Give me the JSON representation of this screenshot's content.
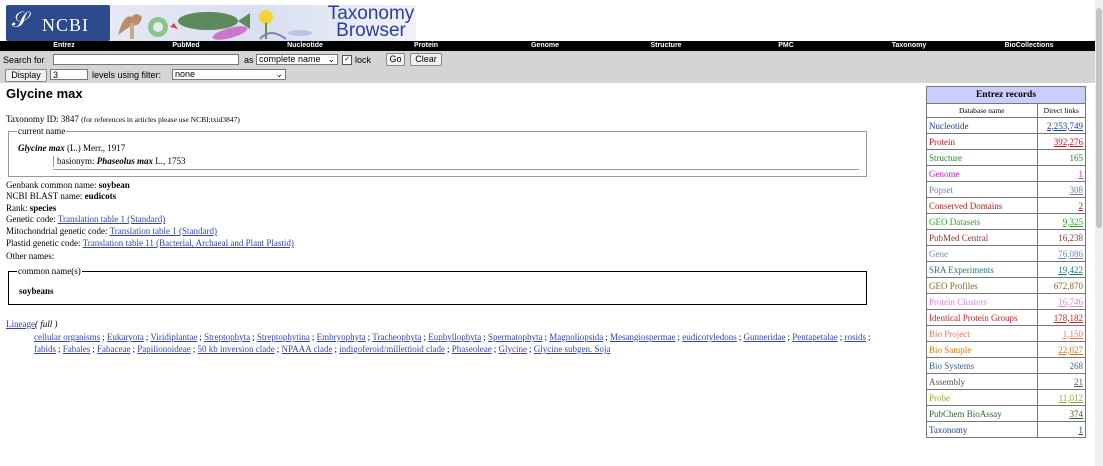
{
  "header": {
    "logo_text": "NCBI",
    "banner_title_line1": "Taxonomy",
    "banner_title_line2": "Browser"
  },
  "nav": [
    "Entrez",
    "PubMed",
    "Nucleotide",
    "Protein",
    "Genome",
    "Structure",
    "PMC",
    "Taxonomy",
    "BioCollections"
  ],
  "search": {
    "search_for_label": "Search for",
    "search_value": "",
    "as_label": "as",
    "mode_value": "complete name",
    "lock_label": "lock",
    "lock_checked": "✓",
    "go_label": "Go",
    "clear_label": "Clear",
    "display_label": "Display",
    "levels_value": "3",
    "levels_label": "levels using filter:",
    "filter_value": "none"
  },
  "taxon": {
    "title": "Glycine max",
    "taxonomy_id_label": "Taxonomy ID: 3847",
    "taxonomy_id_note": "(for references in articles please use NCBI:txid3847)",
    "current_name_legend": "current name",
    "current_name": "Glycine max",
    "current_authority": "(L.) Merr., 1917",
    "basionym_label": "basionym:",
    "basionym_name": "Phaseolus max",
    "basionym_authority": "L., 1753",
    "genbank_label": "Genbank common name:",
    "genbank_value": "soybean",
    "blast_label": "NCBI BLAST name:",
    "blast_value": "eudicots",
    "rank_label": "Rank:",
    "rank_value": "species",
    "genetic_label": "Genetic code:",
    "genetic_value": "Translation table 1 (Standard)",
    "mito_label": "Mitochondrial genetic code:",
    "mito_value": "Translation table 1 (Standard)",
    "plastid_label": "Plastid genetic code:",
    "plastid_value": "Translation table 11 (Bacterial, Archaeal and Plant Plastid)",
    "other_names_label": "Other names:",
    "common_names_legend": "common name(s)",
    "common_name": "soybeans",
    "lineage_label": "Lineage",
    "lineage_mode": "( full )",
    "lineage": [
      "cellular organisms",
      "Eukaryota",
      "Viridiplantae",
      "Streptophyta",
      "Streptophytina",
      "Embryophyta",
      "Tracheophyta",
      "Euphyllophyta",
      "Spermatophyta",
      "Magnoliopsida",
      "Mesangiospermae",
      "eudicotyledons",
      "Gunneridae",
      "Pentapetalae",
      "rosids",
      "fabids",
      "Fabales",
      "Fabaceae",
      "Papilionoideae",
      "50 kb inversion clade",
      "NPAAA clade",
      "indigoferoid/millettioid clade",
      "Phaseoleae",
      "Glycine",
      "Glycine subgen. Soja"
    ]
  },
  "entrez": {
    "title": "Entrez records",
    "col_db": "Database name",
    "col_links": "Direct links",
    "rows": [
      {
        "name": "Nucleotide",
        "value": "2,253,749",
        "color": "#1a3c9e",
        "link": true
      },
      {
        "name": "Protein",
        "value": "392,276",
        "color": "#cc1122",
        "link": true
      },
      {
        "name": "Structure",
        "value": "165",
        "color": "#228822",
        "link": false
      },
      {
        "name": "Genome",
        "value": "1",
        "color": "#cc22cc",
        "link": true
      },
      {
        "name": "Popset",
        "value": "308",
        "color": "#6f7faa",
        "link": true
      },
      {
        "name": "Conserved Domains",
        "value": "2",
        "color": "#aa2222",
        "link": true
      },
      {
        "name": "GEO Datasets",
        "value": "9,325",
        "color": "#22aa22",
        "link": true
      },
      {
        "name": "PubMed Central",
        "value": "16,238",
        "color": "#993333",
        "link": false
      },
      {
        "name": "Gene",
        "value": "76,086",
        "color": "#7788bb",
        "link": true
      },
      {
        "name": "SRA Experiments",
        "value": "19,422",
        "color": "#227777",
        "link": true
      },
      {
        "name": "GEO Profiles",
        "value": "672,870",
        "color": "#886622",
        "link": false
      },
      {
        "name": "Protein Clusters",
        "value": "16,746",
        "color": "#dd88dd",
        "link": true
      },
      {
        "name": "Identical Protein Groups",
        "value": "178,182",
        "color": "#cc2222",
        "link": true
      },
      {
        "name": "Bio Project",
        "value": "1,150",
        "color": "#ee7766",
        "link": true
      },
      {
        "name": "Bio Sample",
        "value": "22,027",
        "color": "#dd7711",
        "link": true
      },
      {
        "name": "Bio Systems",
        "value": "268",
        "color": "#336699",
        "link": false
      },
      {
        "name": "Assembly",
        "value": "21",
        "color": "#555555",
        "link": true
      },
      {
        "name": "Probe",
        "value": "11,012",
        "color": "#99aa33",
        "link": true
      },
      {
        "name": "PubChem BioAssay",
        "value": "374",
        "color": "#336633",
        "link": true
      },
      {
        "name": "Taxonomy",
        "value": "1",
        "color": "#1a3c9e",
        "link": true
      }
    ]
  }
}
